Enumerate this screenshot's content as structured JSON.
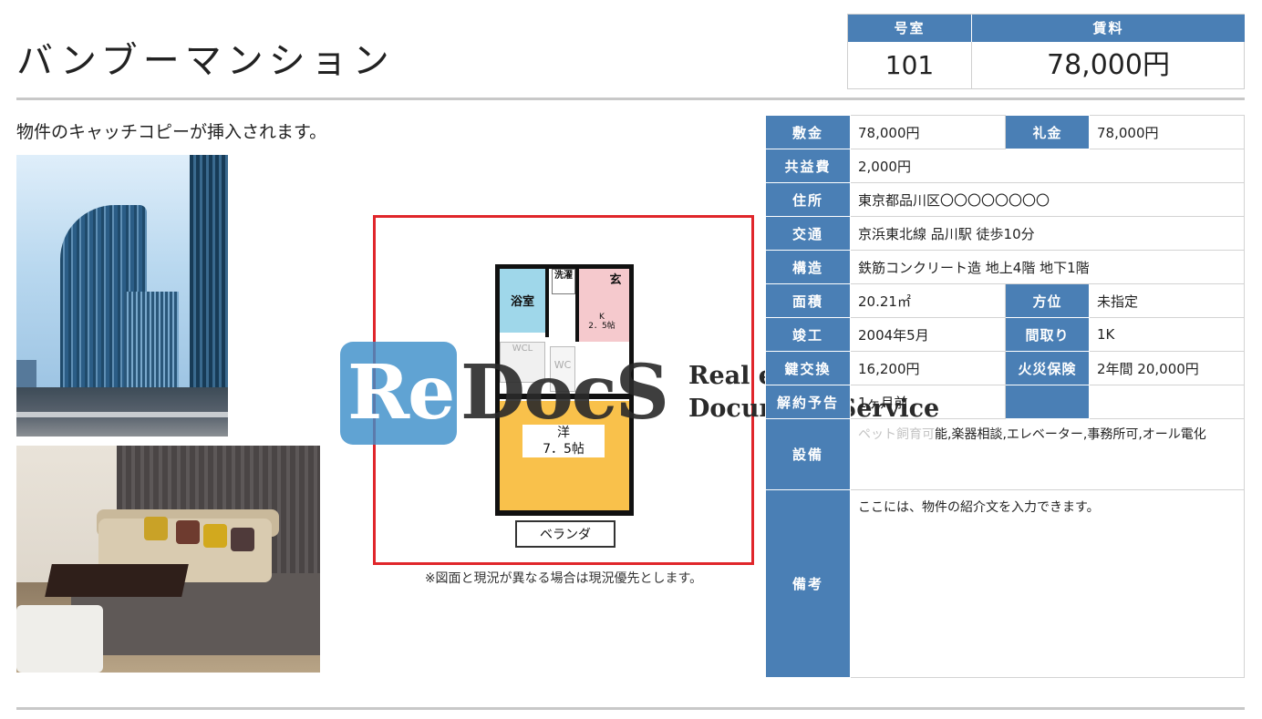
{
  "property": {
    "name": "バンブーマンション",
    "catch_copy": "物件のキャッチコピーが挿入されます。"
  },
  "room": {
    "room_header": "号室",
    "rent_header": "賃料",
    "room_number": "101",
    "rent": "78,000円"
  },
  "floorplan": {
    "note": "※図面と現況が異なる場合は現況優先とします。",
    "labels": {
      "bath": "浴室",
      "laundry": "洗濯",
      "entrance": "玄",
      "kitchen": "K\n2．5帖",
      "wcl": "WCL",
      "wc": "WC",
      "western": "洋\n7．5帖",
      "balcony": "ベランダ"
    }
  },
  "watermark": {
    "re": "Re",
    "docs": "DocS",
    "line1": "Real estate",
    "line2": "Document Service"
  },
  "info": {
    "shikikin_label": "敷金",
    "shikikin": "78,000円",
    "reikin_label": "礼金",
    "reikin": "78,000円",
    "kyoeki_label": "共益費",
    "kyoeki": "2,000円",
    "address_label": "住所",
    "address": "東京都品川区〇〇〇〇〇〇〇〇",
    "access_label": "交通",
    "access": "京浜東北線 品川駅 徒歩10分",
    "structure_label": "構造",
    "structure": "鉄筋コンクリート造 地上4階 地下1階",
    "area_label": "面積",
    "area": "20.21㎡",
    "direction_label": "方位",
    "direction": "未指定",
    "built_label": "竣工",
    "built": "2004年5月",
    "layout_label": "間取り",
    "layout": "1K",
    "key_label": "鍵交換",
    "key": "16,200円",
    "insurance_label": "火災保険",
    "insurance": "2年間 20,000円",
    "cancel_label": "解約予告",
    "cancel": "1ヶ月前",
    "equipment_label": "設備",
    "equipment_faded": "ペット飼育可",
    "equipment": "能,楽器相談,エレベーター,事務所可,オール電化",
    "remarks_label": "備考",
    "remarks": "ここには、物件の紹介文を入力できます。"
  },
  "colors": {
    "header_blue": "#4a7fb5",
    "frame_red": "#e0262b",
    "bath_blue": "#9fd7ea",
    "kitchen_pink": "#f5c9cd",
    "western_yellow": "#f9c14b"
  }
}
